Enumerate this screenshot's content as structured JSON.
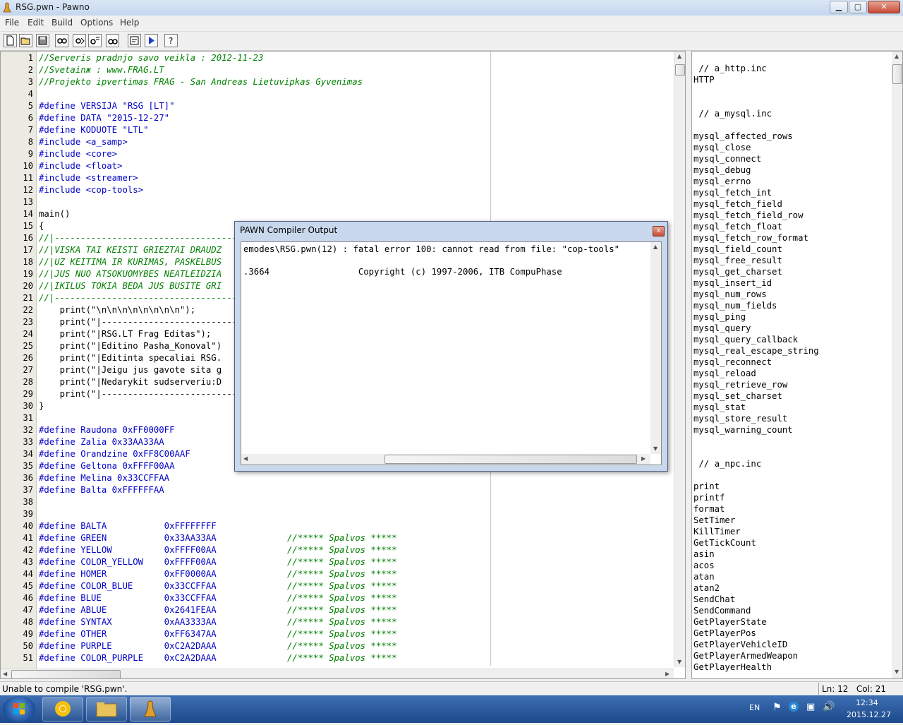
{
  "window": {
    "title": "RSG.pwn - Pawno"
  },
  "menu": [
    "File",
    "Edit",
    "Build",
    "Options",
    "Help"
  ],
  "toolbar": [
    "new-icon",
    "open-icon",
    "save-icon",
    "find-icon",
    "find-next-icon",
    "replace-icon",
    "goto-icon",
    "compile-icon",
    "run-icon",
    "help-icon"
  ],
  "editor": {
    "lines": [
      {
        "n": "1",
        "t": "//Serveris pradлjo savo veikla : 2012-11-23",
        "c": "cm"
      },
      {
        "n": "2",
        "t": "//Svetainж : www.FRAG.LT",
        "c": "cm"
      },
      {
        "n": "3",
        "t": "//Projekto ipvertimas FRAG - San Andreas Lietuvipkas Gyvenimas",
        "c": "cm"
      },
      {
        "n": "4",
        "t": "",
        "c": ""
      },
      {
        "n": "5",
        "t": "#define VERSIJA \"RSG [LT]\"",
        "c": "kw"
      },
      {
        "n": "6",
        "t": "#define DATA \"2015-12-27\"",
        "c": "kw"
      },
      {
        "n": "7",
        "t": "#define KODUOTE \"LTL\"",
        "c": "kw"
      },
      {
        "n": "8",
        "t": "#include <a_samp>",
        "c": "kw"
      },
      {
        "n": "9",
        "t": "#include <core>",
        "c": "kw"
      },
      {
        "n": "10",
        "t": "#include <float>",
        "c": "kw"
      },
      {
        "n": "11",
        "t": "#include <streamer>",
        "c": "kw"
      },
      {
        "n": "12",
        "t": "#include <cop-tools>",
        "c": "kw"
      },
      {
        "n": "13",
        "t": "",
        "c": ""
      },
      {
        "n": "14",
        "t": "main()",
        "c": ""
      },
      {
        "n": "15",
        "t": "{",
        "c": ""
      },
      {
        "n": "16",
        "t": "//|------------------------------------",
        "c": "cm"
      },
      {
        "n": "17",
        "t": "//|VISKA TAI KEISTI GRIEZTAI DRAUDZ",
        "c": "cm"
      },
      {
        "n": "18",
        "t": "//|UZ KEITIMA IR KURIMAS, PASKELBUS",
        "c": "cm"
      },
      {
        "n": "19",
        "t": "//|JUS NUO ATSOKUOMYBES NEATLEIDZIA",
        "c": "cm"
      },
      {
        "n": "20",
        "t": "//|IKILUS TOKIA BEDA JUS BUSITE GRI",
        "c": "cm"
      },
      {
        "n": "21",
        "t": "//|------------------------------------",
        "c": "cm"
      },
      {
        "n": "22",
        "t": "    print(\"\\n\\n\\n\\n\\n\\n\\n\\n\");",
        "c": ""
      },
      {
        "n": "23",
        "t": "    print(\"|-----------------------------",
        "c": ""
      },
      {
        "n": "24",
        "t": "    print(\"|RSG.LT Frag Editas\");",
        "c": ""
      },
      {
        "n": "25",
        "t": "    print(\"|Editino Pasha_Konoval\")",
        "c": ""
      },
      {
        "n": "26",
        "t": "    print(\"|Editinta specaliai RSG.",
        "c": ""
      },
      {
        "n": "27",
        "t": "    print(\"|Jeigu jus gavote sita g",
        "c": ""
      },
      {
        "n": "28",
        "t": "    print(\"|Nedarykit sudserveriu:D",
        "c": ""
      },
      {
        "n": "29",
        "t": "    print(\"|-----------------------------",
        "c": ""
      },
      {
        "n": "30",
        "t": "}",
        "c": ""
      },
      {
        "n": "31",
        "t": "",
        "c": ""
      },
      {
        "n": "32",
        "t": "#define Raudona 0xFF0000FF",
        "c": "kw"
      },
      {
        "n": "33",
        "t": "#define Zalia 0x33AA33AA",
        "c": "kw"
      },
      {
        "n": "34",
        "t": "#define Orandzine 0xFF8C00AAF",
        "c": "kw"
      },
      {
        "n": "35",
        "t": "#define Geltona 0xFFFF00AA",
        "c": "kw"
      },
      {
        "n": "36",
        "t": "#define Melina 0x33CCFFAA",
        "c": "kw"
      },
      {
        "n": "37",
        "t": "#define Balta 0xFFFFFFAA",
        "c": "kw"
      },
      {
        "n": "38",
        "t": "",
        "c": ""
      },
      {
        "n": "39",
        "t": "",
        "c": ""
      },
      {
        "n": "40",
        "t": "#define BALTA           0xFFFFFFFF",
        "c": "kw"
      },
      {
        "n": "41",
        "t": "#define GREEN           0x33AA33AA",
        "c": "kw",
        "s": "//***** Spalvos *****"
      },
      {
        "n": "42",
        "t": "#define YELLOW          0xFFFF00AA",
        "c": "kw",
        "s": "//***** Spalvos *****"
      },
      {
        "n": "43",
        "t": "#define COLOR_YELLOW    0xFFFF00AA",
        "c": "kw",
        "s": "//***** Spalvos *****"
      },
      {
        "n": "44",
        "t": "#define HOMER           0xFF0000AA",
        "c": "kw",
        "s": "//***** Spalvos *****"
      },
      {
        "n": "45",
        "t": "#define COLOR_BLUE      0x33CCFFAA",
        "c": "kw",
        "s": "//***** Spalvos *****"
      },
      {
        "n": "46",
        "t": "#define BLUE            0x33CCFFAA",
        "c": "kw",
        "s": "//***** Spalvos *****"
      },
      {
        "n": "47",
        "t": "#define ABLUE           0x2641FEAA",
        "c": "kw",
        "s": "//***** Spalvos *****"
      },
      {
        "n": "48",
        "t": "#define SYNTAX          0xAA3333AA",
        "c": "kw",
        "s": "//***** Spalvos *****"
      },
      {
        "n": "49",
        "t": "#define OTHER           0xFF6347AA",
        "c": "kw",
        "s": "//***** Spalvos *****"
      },
      {
        "n": "50",
        "t": "#define PURPLE          0xC2A2DAAA",
        "c": "kw",
        "s": "//***** Spalvos *****"
      },
      {
        "n": "51",
        "t": "#define COLOR_PURPLE    0xC2A2DAAA",
        "c": "kw",
        "s": "//***** Spalvos *****"
      }
    ]
  },
  "functions": [
    {
      "t": " // a_http.inc",
      "h": true
    },
    {
      "t": "HTTP"
    },
    {
      "t": ""
    },
    {
      "t": ""
    },
    {
      "t": " // a_mysql.inc",
      "h": true
    },
    {
      "t": ""
    },
    {
      "t": "mysql_affected_rows"
    },
    {
      "t": "mysql_close"
    },
    {
      "t": "mysql_connect"
    },
    {
      "t": "mysql_debug"
    },
    {
      "t": "mysql_errno"
    },
    {
      "t": "mysql_fetch_int"
    },
    {
      "t": "mysql_fetch_field"
    },
    {
      "t": "mysql_fetch_field_row"
    },
    {
      "t": "mysql_fetch_float"
    },
    {
      "t": "mysql_fetch_row_format"
    },
    {
      "t": "mysql_field_count"
    },
    {
      "t": "mysql_free_result"
    },
    {
      "t": "mysql_get_charset"
    },
    {
      "t": "mysql_insert_id"
    },
    {
      "t": "mysql_num_rows"
    },
    {
      "t": "mysql_num_fields"
    },
    {
      "t": "mysql_ping"
    },
    {
      "t": "mysql_query"
    },
    {
      "t": "mysql_query_callback"
    },
    {
      "t": "mysql_real_escape_string"
    },
    {
      "t": "mysql_reconnect"
    },
    {
      "t": "mysql_reload"
    },
    {
      "t": "mysql_retrieve_row"
    },
    {
      "t": "mysql_set_charset"
    },
    {
      "t": "mysql_stat"
    },
    {
      "t": "mysql_store_result"
    },
    {
      "t": "mysql_warning_count"
    },
    {
      "t": ""
    },
    {
      "t": ""
    },
    {
      "t": " // a_npc.inc",
      "h": true
    },
    {
      "t": ""
    },
    {
      "t": "print"
    },
    {
      "t": "printf"
    },
    {
      "t": "format"
    },
    {
      "t": "SetTimer"
    },
    {
      "t": "KillTimer"
    },
    {
      "t": "GetTickCount"
    },
    {
      "t": "asin"
    },
    {
      "t": "acos"
    },
    {
      "t": "atan"
    },
    {
      "t": "atan2"
    },
    {
      "t": "SendChat"
    },
    {
      "t": "SendCommand"
    },
    {
      "t": "GetPlayerState"
    },
    {
      "t": "GetPlayerPos"
    },
    {
      "t": "GetPlayerVehicleID"
    },
    {
      "t": "GetPlayerArmedWeapon"
    },
    {
      "t": "GetPlayerHealth"
    }
  ],
  "dialog": {
    "title": "PAWN Compiler Output",
    "close_label": "x",
    "output": [
      "emodes\\RSG.pwn(12) : fatal error 100: cannot read from file: \"cop-tools\"",
      "",
      ".3664                 Copyright (c) 1997-2006, ITB CompuPhase"
    ]
  },
  "status": {
    "message": "Unable to compile 'RSG.pwn'.",
    "position": "Ln: 12   Col: 21"
  },
  "taskbar": {
    "lang": "EN",
    "time": "12:34",
    "date": "2015.12.27"
  },
  "colors": {
    "comment": "#008000",
    "keyword": "#0000c8",
    "gutter": "#ecebe3",
    "taskbar": "#1c4a8c"
  }
}
